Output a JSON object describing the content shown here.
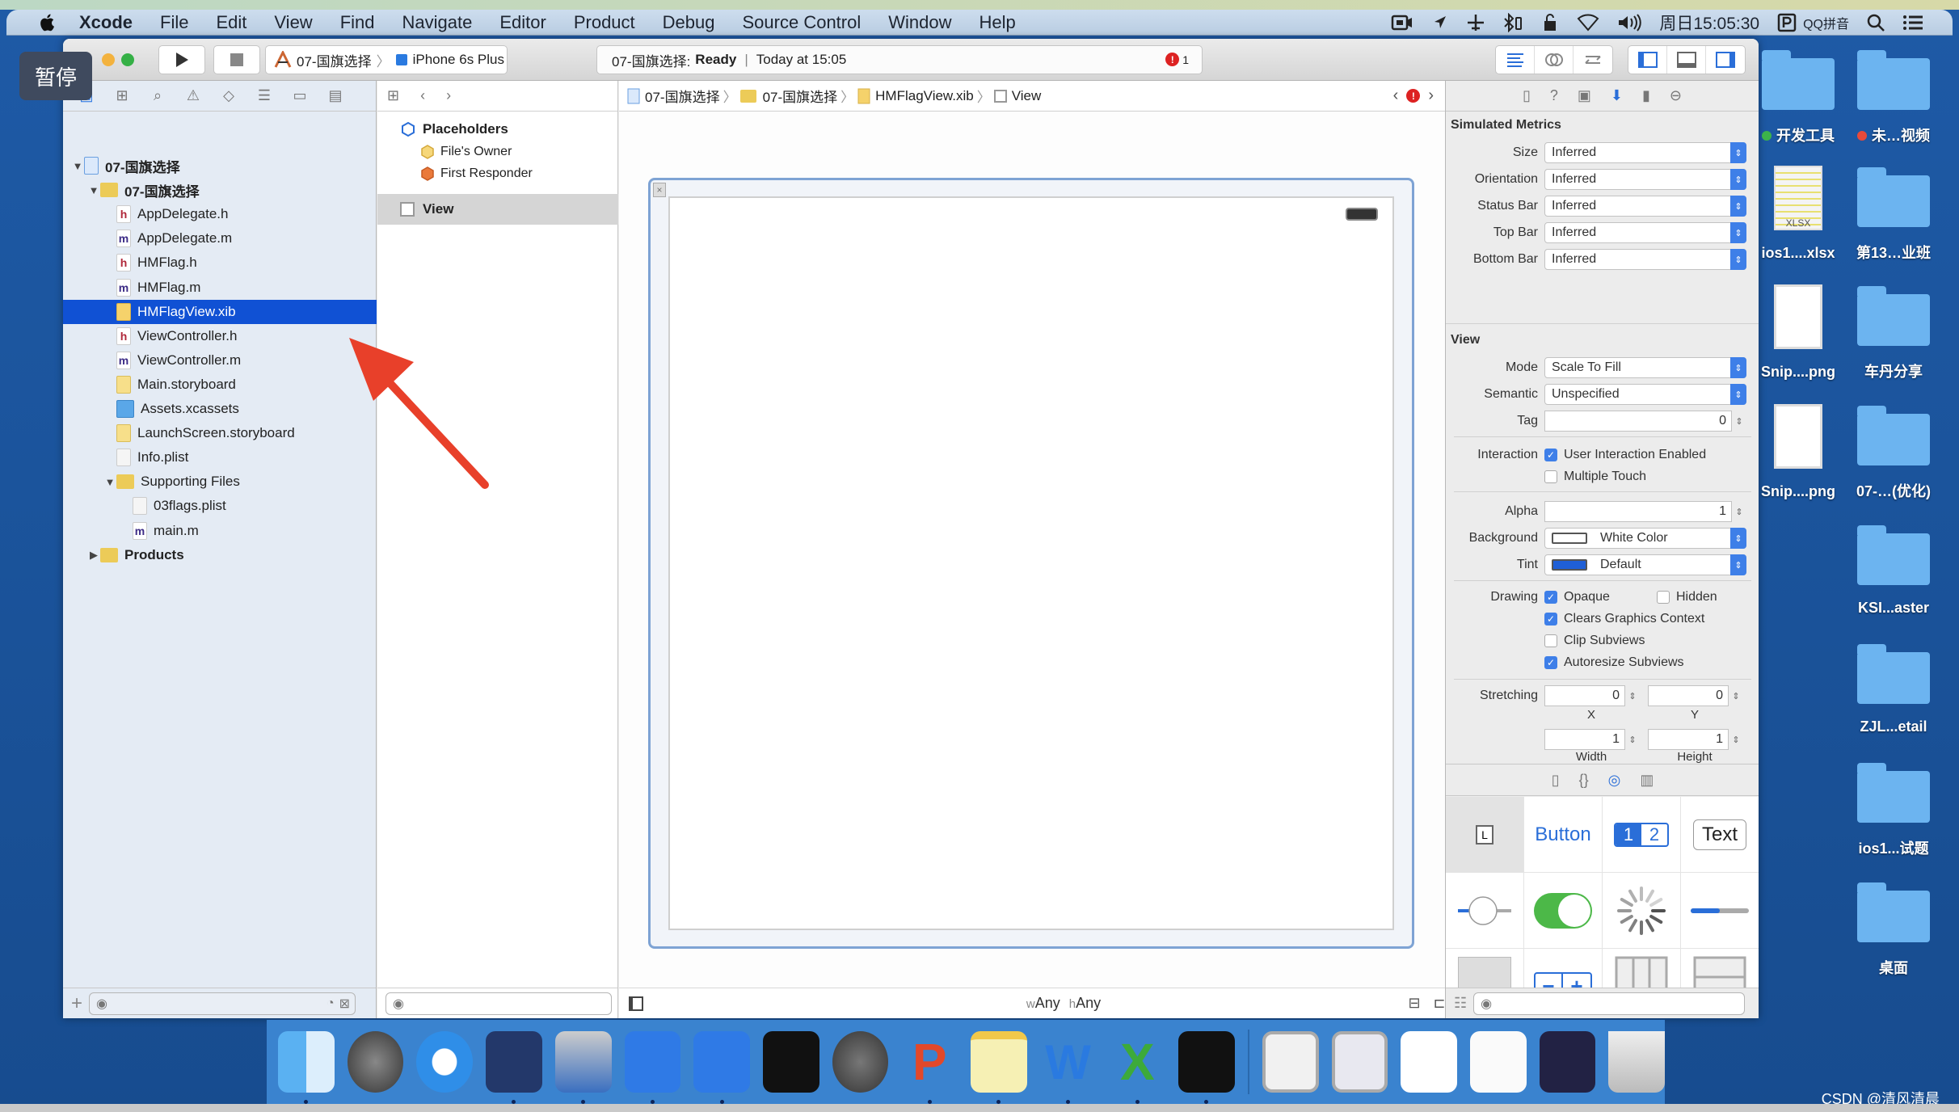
{
  "menubar": {
    "app_name": "Xcode",
    "items": [
      "File",
      "Edit",
      "View",
      "Find",
      "Navigate",
      "Editor",
      "Product",
      "Debug",
      "Source Control",
      "Window",
      "Help"
    ],
    "clock": "周日15:05:30",
    "input_method": "QQ拼音"
  },
  "overlay": {
    "pause_label": "暂停"
  },
  "toolbar": {
    "scheme_target": "07-国旗选择",
    "device": "iPhone 6s Plus",
    "activity_project": "07-国旗选择:",
    "activity_status": "Ready",
    "activity_separator": "|",
    "activity_time": "Today at 15:05",
    "error_count": "1"
  },
  "navigator": {
    "items": [
      {
        "label": "07-国旗选择",
        "type": "project",
        "level": 0,
        "expanded": true
      },
      {
        "label": "07-国旗选择",
        "type": "folder",
        "level": 1,
        "expanded": true
      },
      {
        "label": "AppDelegate.h",
        "type": "h",
        "level": 2
      },
      {
        "label": "AppDelegate.m",
        "type": "m",
        "level": 2
      },
      {
        "label": "HMFlag.h",
        "type": "h",
        "level": 2
      },
      {
        "label": "HMFlag.m",
        "type": "m",
        "level": 2
      },
      {
        "label": "HMFlagView.xib",
        "type": "xib",
        "level": 2,
        "selected": true
      },
      {
        "label": "ViewController.h",
        "type": "h",
        "level": 2
      },
      {
        "label": "ViewController.m",
        "type": "m",
        "level": 2
      },
      {
        "label": "Main.storyboard",
        "type": "sb",
        "level": 2
      },
      {
        "label": "Assets.xcassets",
        "type": "assets",
        "level": 2
      },
      {
        "label": "LaunchScreen.storyboard",
        "type": "sb",
        "level": 2
      },
      {
        "label": "Info.plist",
        "type": "plist",
        "level": 2
      },
      {
        "label": "Supporting Files",
        "type": "folder",
        "level": 2,
        "expanded": true
      },
      {
        "label": "03flags.plist",
        "type": "plist",
        "level": 3
      },
      {
        "label": "main.m",
        "type": "m",
        "level": 3
      },
      {
        "label": "Products",
        "type": "folder",
        "level": 1,
        "expanded": false
      }
    ]
  },
  "jumpbar": {
    "crumbs": [
      "07-国旗选择",
      "07-国旗选择",
      "HMFlagView.xib",
      "View"
    ]
  },
  "outline": {
    "placeholders": "Placeholders",
    "files_owner": "File's Owner",
    "first_responder": "First Responder",
    "view": "View"
  },
  "canvas": {
    "size_class_w": "w",
    "size_class_w_val": "Any",
    "size_class_h": "h",
    "size_class_h_val": "Any"
  },
  "inspector": {
    "simulated_metrics_title": "Simulated Metrics",
    "simulated_metrics": [
      {
        "label": "Size",
        "value": "Inferred"
      },
      {
        "label": "Orientation",
        "value": "Inferred"
      },
      {
        "label": "Status Bar",
        "value": "Inferred"
      },
      {
        "label": "Top Bar",
        "value": "Inferred"
      },
      {
        "label": "Bottom Bar",
        "value": "Inferred"
      }
    ],
    "view_title": "View",
    "mode_label": "Mode",
    "mode_value": "Scale To Fill",
    "semantic_label": "Semantic",
    "semantic_value": "Unspecified",
    "tag_label": "Tag",
    "tag_value": "0",
    "interaction_label": "Interaction",
    "user_interaction": {
      "label": "User Interaction Enabled",
      "checked": true
    },
    "multiple_touch": {
      "label": "Multiple Touch",
      "checked": false
    },
    "alpha_label": "Alpha",
    "alpha_value": "1",
    "background_label": "Background",
    "background_value": "White Color",
    "background_color": "#ffffff",
    "tint_label": "Tint",
    "tint_value": "Default",
    "tint_color": "#1f5fd6",
    "drawing_label": "Drawing",
    "opaque": {
      "label": "Opaque",
      "checked": true
    },
    "hidden": {
      "label": "Hidden",
      "checked": false
    },
    "clears_graphics": {
      "label": "Clears Graphics Context",
      "checked": true
    },
    "clip_subviews": {
      "label": "Clip Subviews",
      "checked": false
    },
    "autoresize_subviews": {
      "label": "Autoresize Subviews",
      "checked": true
    },
    "stretching_label": "Stretching",
    "stretch_x": "0",
    "stretch_y": "0",
    "stretch_w": "1",
    "stretch_h": "1",
    "x_label": "X",
    "y_label": "Y",
    "width_label": "Width",
    "height_label": "Height"
  },
  "library": {
    "button_label": "Button",
    "seg_1": "1",
    "seg_2": "2",
    "text_label": "Text",
    "label_glyph": "L"
  },
  "desktop": {
    "icons": [
      {
        "label": "开发工具",
        "kind": "folder",
        "tag": "#3cb34a"
      },
      {
        "label": "未…视频",
        "kind": "folder",
        "tag": "#e84a3a"
      },
      {
        "label": "ios1....xlsx",
        "kind": "xlsx"
      },
      {
        "label": "第13…业班",
        "kind": "folder"
      },
      {
        "label": "Snip....png",
        "kind": "png"
      },
      {
        "label": "车丹分享",
        "kind": "folder"
      },
      {
        "label": "Snip....png",
        "kind": "png"
      },
      {
        "label": "07-…(优化)",
        "kind": "folder"
      },
      {
        "label": "KSI...aster",
        "kind": "folder"
      },
      {
        "label": "ZJL...etail",
        "kind": "folder"
      },
      {
        "label": "ios1...试题",
        "kind": "folder"
      },
      {
        "label": "桌面",
        "kind": "folder"
      }
    ],
    "xlsx_badge": "XLSX"
  },
  "dock": {
    "apps": [
      "Finder",
      "Launchpad",
      "Safari",
      "Mouse",
      "Video",
      "Xcode",
      "Simulator",
      "Terminal",
      "System Preferences",
      "PowerPoint",
      "Notes",
      "Word",
      "Excel",
      "Console",
      "Window 1",
      "Window 2",
      "Document",
      "Preview",
      "Screenshot",
      "Trash"
    ]
  },
  "watermark": "CSDN @清风清晨"
}
